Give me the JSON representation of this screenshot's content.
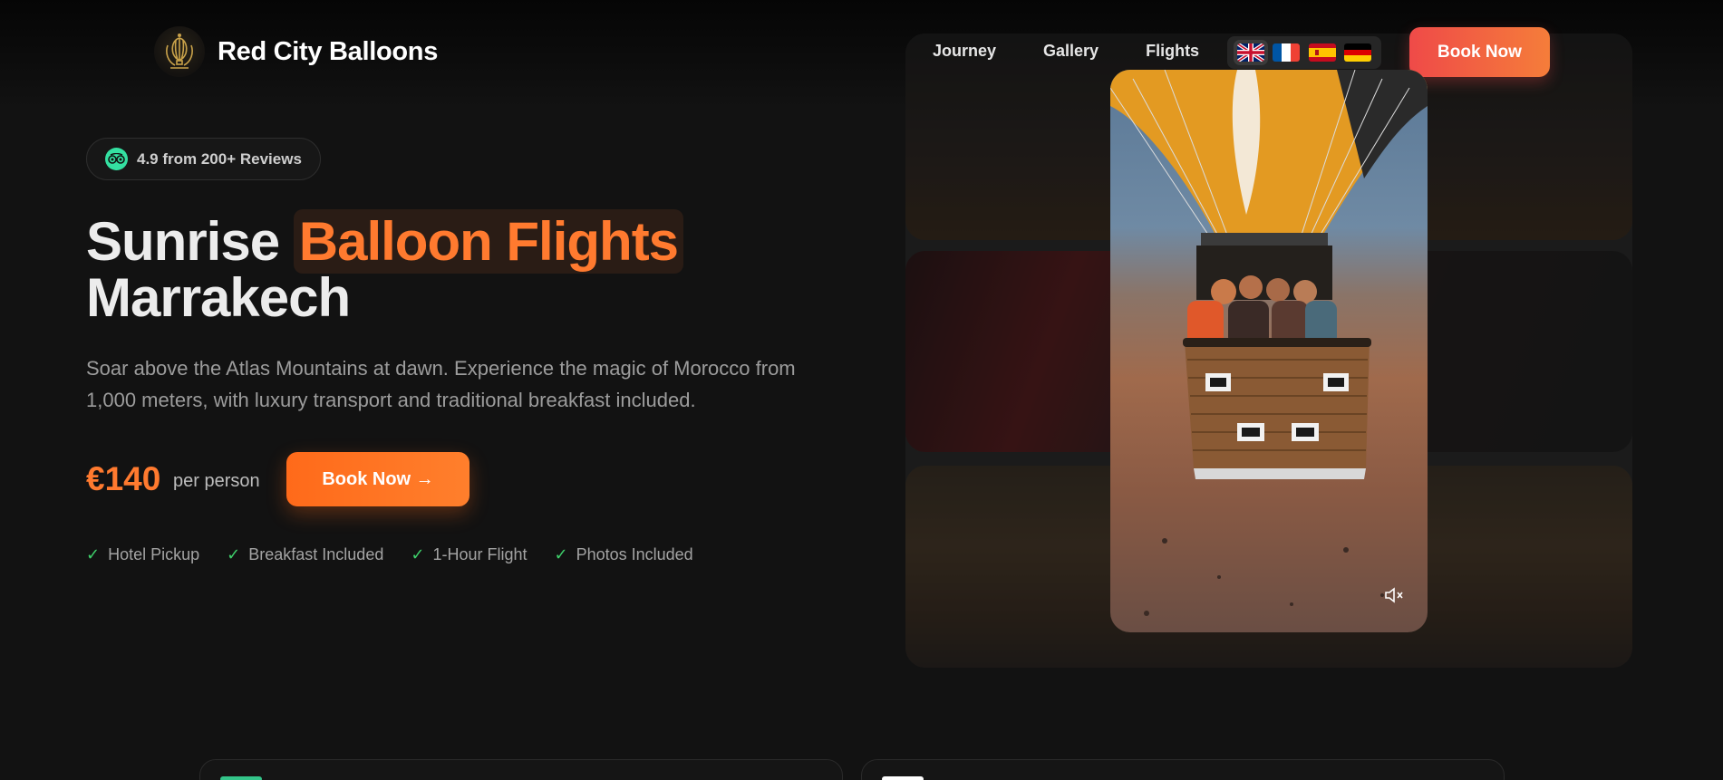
{
  "brand": {
    "name": "Red City Balloons"
  },
  "nav": {
    "items": [
      {
        "label": "Journey"
      },
      {
        "label": "Gallery"
      },
      {
        "label": "Flights"
      }
    ],
    "languages": [
      "uk-flag-icon",
      "france-flag-icon",
      "spain-flag-icon",
      "germany-flag-icon"
    ],
    "book_label": "Book Now"
  },
  "hero": {
    "rating": "4.9 from 200+ Reviews",
    "title_pre": "Sunrise",
    "title_highlight": "Balloon Flights",
    "title_line2": "Marrakech",
    "description": "Soar above the Atlas Mountains at dawn. Experience the magic of Morocco from 1,000 meters, with luxury transport and traditional breakfast included.",
    "price": "€140",
    "price_unit": "per person",
    "cta_label": "Book Now →",
    "features": [
      {
        "label": "Hotel Pickup"
      },
      {
        "label": "Breakfast Included"
      },
      {
        "label": "1-Hour Flight"
      },
      {
        "label": "Photos Included"
      }
    ],
    "check_glyph": "✓"
  },
  "colors": {
    "accent": "#ff7a2f",
    "background": "#121212",
    "check": "#3ecf6a",
    "tripadvisor": "#34e0a1"
  }
}
